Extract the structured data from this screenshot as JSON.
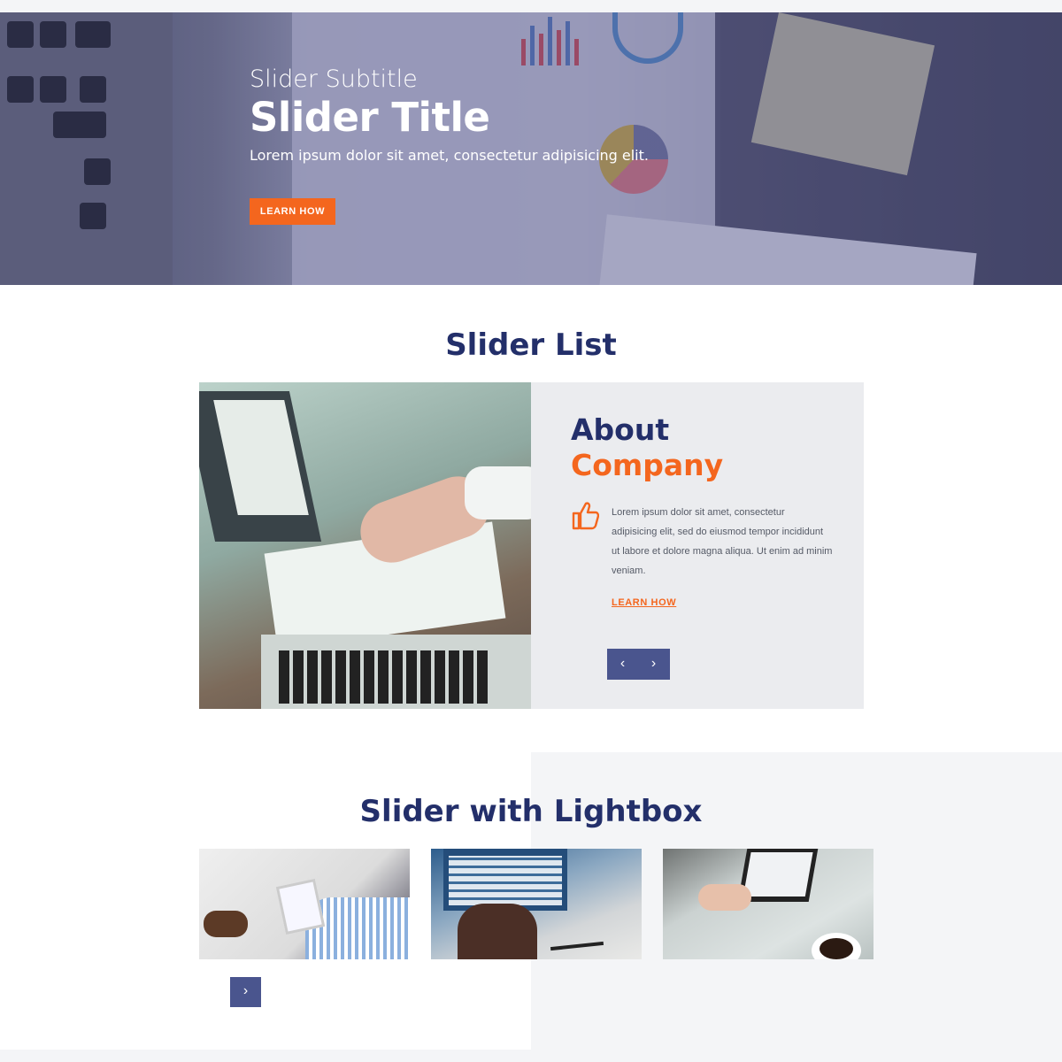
{
  "hero": {
    "subtitle": "Slider Subtitle",
    "title": "Slider Title",
    "description": "Lorem ipsum dolor sit amet, consectetur adipisicing elit.",
    "button_label": "LEARN HOW"
  },
  "slider_list": {
    "title": "Slider List",
    "card": {
      "heading_line1": "About",
      "heading_line2": "Company",
      "icon": "thumbs-up-icon",
      "body": "Lorem ipsum dolor sit amet, consectetur adipisicing elit, sed do eiusmod tempor incididunt ut labore et dolore magna aliqua. Ut enim ad minim veniam.",
      "link_label": "LEARN HOW",
      "prev_glyph": "‹",
      "next_glyph": "›"
    }
  },
  "lightbox": {
    "title": "Slider with Lightbox",
    "next_glyph": "›"
  },
  "colors": {
    "navy": "#232f6a",
    "orange": "#f4661e",
    "nav_button": "#4a558e",
    "card_bg": "#ebecef",
    "section_bg": "#f4f5f7"
  }
}
